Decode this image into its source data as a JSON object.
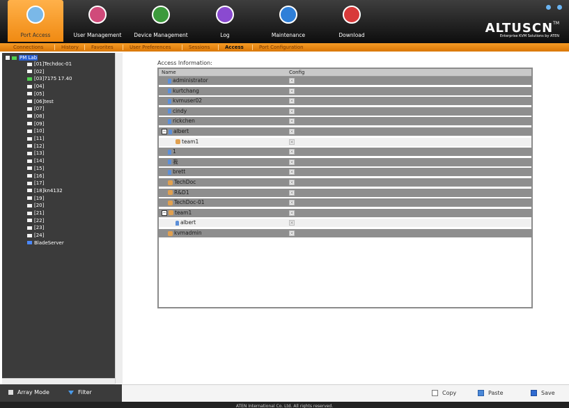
{
  "tabs": [
    {
      "label": "Port Access"
    },
    {
      "label": "User Management"
    },
    {
      "label": "Device Management"
    },
    {
      "label": "Log"
    },
    {
      "label": "Maintenance"
    },
    {
      "label": "Download"
    }
  ],
  "logo": {
    "name": "ALTUSCN",
    "tm": "TM",
    "tagline": "Enterprise KVM Solutions by ATEN"
  },
  "subnav": [
    "Connections",
    "History",
    "Favorites",
    "User Preferences",
    "Sessions",
    "Access",
    "Port Configuration"
  ],
  "tree": {
    "root": "PM Lab",
    "items": [
      "[01]Techdoc-01",
      "[02]",
      "[03]7175 17.40",
      "[04]",
      "[05]",
      "[06]test",
      "[07]",
      "[08]",
      "[09]",
      "[10]",
      "[11]",
      "[12]",
      "[13]",
      "[14]",
      "[15]",
      "[16]",
      "[17]",
      "[18]kn4132",
      "[19]",
      "[20]",
      "[21]",
      "[22]",
      "[23]",
      "[24]",
      "BladeServer"
    ]
  },
  "access": {
    "label": "Access Information:",
    "headers": {
      "name": "Name",
      "config": "Config"
    },
    "rows": [
      {
        "name": "administrator",
        "type": "user"
      },
      {
        "name": "kurtchang",
        "type": "user"
      },
      {
        "name": "kvmuser02",
        "type": "user"
      },
      {
        "name": "cindy",
        "type": "user"
      },
      {
        "name": "rickchen",
        "type": "user"
      },
      {
        "name": "albert",
        "type": "user",
        "expand": "−"
      },
      {
        "name": "team1",
        "type": "group",
        "child": true
      },
      {
        "name": "1",
        "type": "user"
      },
      {
        "name": "我",
        "type": "user"
      },
      {
        "name": "brett",
        "type": "user"
      },
      {
        "name": "TechDoc",
        "type": "group"
      },
      {
        "name": "R&D1",
        "type": "group"
      },
      {
        "name": "TechDoc-01",
        "type": "group"
      },
      {
        "name": "team1",
        "type": "group",
        "expand": "−"
      },
      {
        "name": "albert",
        "type": "user",
        "child": true
      },
      {
        "name": "kvmadmin",
        "type": "group"
      }
    ]
  },
  "bottom": {
    "array_mode": "Array Mode",
    "filter": "Filter",
    "copy": "Copy",
    "paste": "Paste",
    "save": "Save"
  },
  "footer": "ATEN International Co. Ltd. All rights reserved."
}
